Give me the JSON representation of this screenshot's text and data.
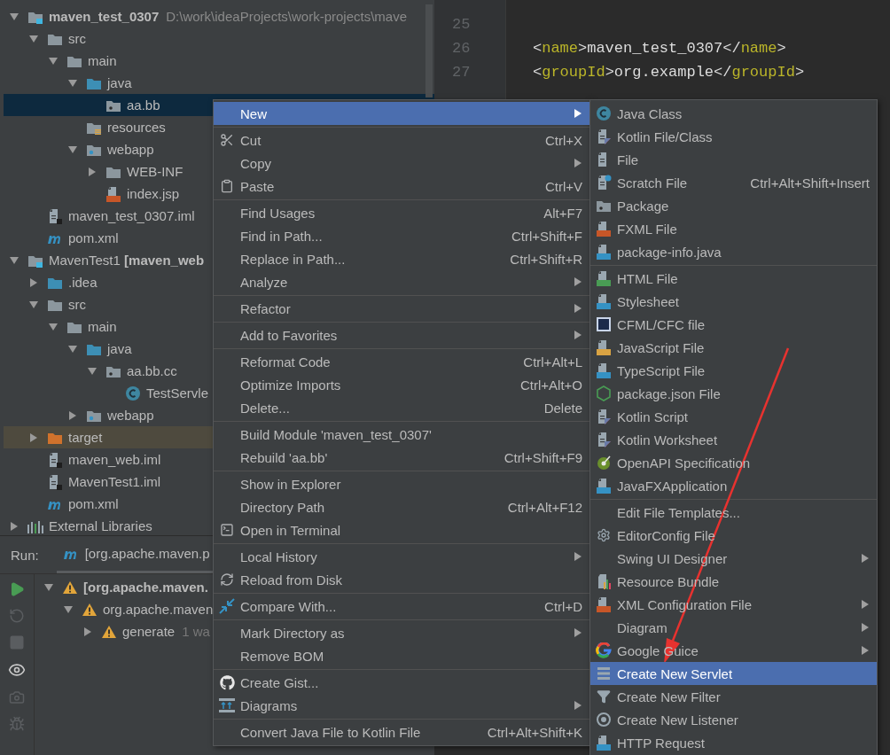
{
  "project_tree": {
    "items": [
      {
        "label": "maven_test_0307",
        "bold": true,
        "path": "D:\\work\\ideaProjects\\work-projects\\mave",
        "kind": "module",
        "expanded": true,
        "selected": false,
        "children": [
          {
            "label": "src",
            "kind": "folder",
            "expanded": true,
            "selected": false,
            "children": [
              {
                "label": "main",
                "kind": "folder",
                "expanded": true,
                "selected": false,
                "children": [
                  {
                    "label": "java",
                    "kind": "source-folder",
                    "expanded": true,
                    "selected": false,
                    "children": [
                      {
                        "label": "aa.bb",
                        "kind": "package",
                        "selected": true
                      }
                    ]
                  },
                  {
                    "label": "resources",
                    "kind": "resources-folder",
                    "selected": false
                  },
                  {
                    "label": "webapp",
                    "kind": "web-folder",
                    "expanded": true,
                    "selected": false,
                    "children": [
                      {
                        "label": "WEB-INF",
                        "kind": "folder",
                        "expanded": false,
                        "selected": false
                      },
                      {
                        "label": "index.jsp",
                        "kind": "jsp-file",
                        "selected": false
                      }
                    ]
                  }
                ]
              }
            ]
          },
          {
            "label": "maven_test_0307.iml",
            "kind": "iml-file",
            "selected": false
          },
          {
            "label": "pom.xml",
            "kind": "maven-file",
            "selected": false
          }
        ]
      },
      {
        "label": "MavenTest1 **[maven_web**",
        "kind": "module",
        "expanded": true,
        "selected": false,
        "children": [
          {
            "label": ".idea",
            "kind": "source-folder",
            "expanded": false,
            "selected": false
          },
          {
            "label": "src",
            "kind": "folder",
            "expanded": true,
            "selected": false,
            "children": [
              {
                "label": "main",
                "kind": "folder",
                "expanded": true,
                "selected": false,
                "children": [
                  {
                    "label": "java",
                    "kind": "source-folder",
                    "expanded": true,
                    "selected": false,
                    "children": [
                      {
                        "label": "aa.bb.cc",
                        "kind": "package",
                        "expanded": true,
                        "selected": false,
                        "children": [
                          {
                            "label": "TestServle",
                            "kind": "class-file",
                            "selected": false
                          }
                        ]
                      }
                    ]
                  },
                  {
                    "label": "webapp",
                    "kind": "web-folder",
                    "expanded": false,
                    "selected": false
                  }
                ]
              }
            ]
          },
          {
            "label": "target",
            "kind": "excluded-folder",
            "expanded": false,
            "selected": false,
            "highlighted": true
          },
          {
            "label": "maven_web.iml",
            "kind": "iml-file",
            "selected": false
          },
          {
            "label": "MavenTest1.iml",
            "kind": "iml-file",
            "selected": false
          },
          {
            "label": "pom.xml",
            "kind": "maven-file",
            "selected": false
          }
        ]
      },
      {
        "label": "External Libraries",
        "kind": "libraries",
        "expanded": false,
        "selected": false
      }
    ]
  },
  "editor": {
    "lines": [
      {
        "number": "25"
      },
      {
        "number": "26",
        "code": "<name>maven_test_0307</name>"
      },
      {
        "number": "27",
        "code": "<groupId>org.example</groupId>"
      }
    ]
  },
  "run_panel": {
    "label": "Run:",
    "tab": "[org.apache.maven.p",
    "tree": [
      {
        "label": "[org.apache.maven.",
        "bold": true,
        "expanded": true,
        "children": [
          {
            "label": "org.apache.maven",
            "expanded": true,
            "children": [
              {
                "label": "generate",
                "expanded": false,
                "note": "1 wa"
              }
            ]
          }
        ]
      }
    ]
  },
  "context_menu": {
    "items": [
      {
        "kind": "item",
        "label": "New",
        "submenu": true,
        "selected": true
      },
      {
        "kind": "separator"
      },
      {
        "kind": "item",
        "label": "Cut",
        "shortcut": "Ctrl+X",
        "submenu": false,
        "selected": false
      },
      {
        "kind": "item",
        "label": "Copy",
        "submenu": true,
        "selected": false
      },
      {
        "kind": "item",
        "label": "Paste",
        "shortcut": "Ctrl+V",
        "submenu": false,
        "selected": false
      },
      {
        "kind": "separator"
      },
      {
        "kind": "item",
        "label": "Find Usages",
        "shortcut": "Alt+F7",
        "submenu": false,
        "selected": false
      },
      {
        "kind": "item",
        "label": "Find in Path...",
        "shortcut": "Ctrl+Shift+F",
        "submenu": false,
        "selected": false
      },
      {
        "kind": "item",
        "label": "Replace in Path...",
        "shortcut": "Ctrl+Shift+R",
        "submenu": false,
        "selected": false
      },
      {
        "kind": "item",
        "label": "Analyze",
        "submenu": true,
        "selected": false
      },
      {
        "kind": "separator"
      },
      {
        "kind": "item",
        "label": "Refactor",
        "submenu": true,
        "selected": false
      },
      {
        "kind": "separator"
      },
      {
        "kind": "item",
        "label": "Add to Favorites",
        "submenu": true,
        "selected": false
      },
      {
        "kind": "separator"
      },
      {
        "kind": "item",
        "label": "Reformat Code",
        "shortcut": "Ctrl+Alt+L",
        "submenu": false,
        "selected": false
      },
      {
        "kind": "item",
        "label": "Optimize Imports",
        "shortcut": "Ctrl+Alt+O",
        "submenu": false,
        "selected": false
      },
      {
        "kind": "item",
        "label": "Delete...",
        "shortcut": "Delete",
        "submenu": false,
        "selected": false
      },
      {
        "kind": "separator"
      },
      {
        "kind": "item",
        "label": "Build Module 'maven_test_0307'",
        "submenu": false,
        "selected": false
      },
      {
        "kind": "item",
        "label": "Rebuild 'aa.bb'",
        "shortcut": "Ctrl+Shift+F9",
        "submenu": false,
        "selected": false
      },
      {
        "kind": "separator"
      },
      {
        "kind": "item",
        "label": "Show in Explorer",
        "submenu": false,
        "selected": false
      },
      {
        "kind": "item",
        "label": "Directory Path",
        "shortcut": "Ctrl+Alt+F12",
        "submenu": false,
        "selected": false
      },
      {
        "kind": "item",
        "label": "Open in Terminal",
        "submenu": false,
        "selected": false
      },
      {
        "kind": "separator"
      },
      {
        "kind": "item",
        "label": "Local History",
        "submenu": true,
        "selected": false
      },
      {
        "kind": "item",
        "label": "Reload from Disk",
        "submenu": false,
        "selected": false
      },
      {
        "kind": "separator"
      },
      {
        "kind": "item",
        "label": "Compare With...",
        "shortcut": "Ctrl+D",
        "submenu": false,
        "selected": false
      },
      {
        "kind": "separator"
      },
      {
        "kind": "item",
        "label": "Mark Directory as",
        "submenu": true,
        "selected": false
      },
      {
        "kind": "item",
        "label": "Remove BOM",
        "submenu": false,
        "selected": false
      },
      {
        "kind": "separator"
      },
      {
        "kind": "item",
        "label": "Create Gist...",
        "submenu": false,
        "selected": false
      },
      {
        "kind": "item",
        "label": "Diagrams",
        "submenu": true,
        "selected": false
      },
      {
        "kind": "separator"
      },
      {
        "kind": "item",
        "label": "Convert Java File to Kotlin File",
        "shortcut": "Ctrl+Alt+Shift+K",
        "submenu": false,
        "selected": false
      }
    ]
  },
  "new_submenu": {
    "items": [
      {
        "kind": "item",
        "label": "Java Class",
        "submenu": false,
        "selected": false
      },
      {
        "kind": "item",
        "label": "Kotlin File/Class",
        "submenu": false,
        "selected": false
      },
      {
        "kind": "item",
        "label": "File",
        "submenu": false,
        "selected": false
      },
      {
        "kind": "item",
        "label": "Scratch File",
        "shortcut": "Ctrl+Alt+Shift+Insert",
        "submenu": false,
        "selected": false
      },
      {
        "kind": "item",
        "label": "Package",
        "submenu": false,
        "selected": false
      },
      {
        "kind": "item",
        "label": "FXML File",
        "submenu": false,
        "selected": false
      },
      {
        "kind": "item",
        "label": "package-info.java",
        "submenu": false,
        "selected": false
      },
      {
        "kind": "separator"
      },
      {
        "kind": "item",
        "label": "HTML File",
        "submenu": false,
        "selected": false
      },
      {
        "kind": "item",
        "label": "Stylesheet",
        "submenu": false,
        "selected": false
      },
      {
        "kind": "item",
        "label": "CFML/CFC file",
        "submenu": false,
        "selected": false
      },
      {
        "kind": "item",
        "label": "JavaScript File",
        "submenu": false,
        "selected": false
      },
      {
        "kind": "item",
        "label": "TypeScript File",
        "submenu": false,
        "selected": false
      },
      {
        "kind": "item",
        "label": "package.json File",
        "submenu": false,
        "selected": false
      },
      {
        "kind": "item",
        "label": "Kotlin Script",
        "submenu": false,
        "selected": false
      },
      {
        "kind": "item",
        "label": "Kotlin Worksheet",
        "submenu": false,
        "selected": false
      },
      {
        "kind": "item",
        "label": "OpenAPI Specification",
        "submenu": false,
        "selected": false
      },
      {
        "kind": "item",
        "label": "JavaFXApplication",
        "submenu": false,
        "selected": false
      },
      {
        "kind": "separator"
      },
      {
        "kind": "item",
        "label": "Edit File Templates...",
        "submenu": false,
        "selected": false
      },
      {
        "kind": "item",
        "label": "EditorConfig File",
        "submenu": false,
        "selected": false
      },
      {
        "kind": "item",
        "label": "Swing UI Designer",
        "submenu": true,
        "selected": false
      },
      {
        "kind": "item",
        "label": "Resource Bundle",
        "submenu": false,
        "selected": false
      },
      {
        "kind": "item",
        "label": "XML Configuration File",
        "submenu": true,
        "selected": false
      },
      {
        "kind": "item",
        "label": "Diagram",
        "submenu": true,
        "selected": false
      },
      {
        "kind": "item",
        "label": "Google Guice",
        "submenu": true,
        "selected": false
      },
      {
        "kind": "item",
        "label": "Create New Servlet",
        "submenu": false,
        "selected": true
      },
      {
        "kind": "item",
        "label": "Create New Filter",
        "submenu": false,
        "selected": false
      },
      {
        "kind": "item",
        "label": "Create New Listener",
        "submenu": false,
        "selected": false
      },
      {
        "kind": "item",
        "label": "HTTP Request",
        "submenu": false,
        "selected": false
      }
    ]
  }
}
